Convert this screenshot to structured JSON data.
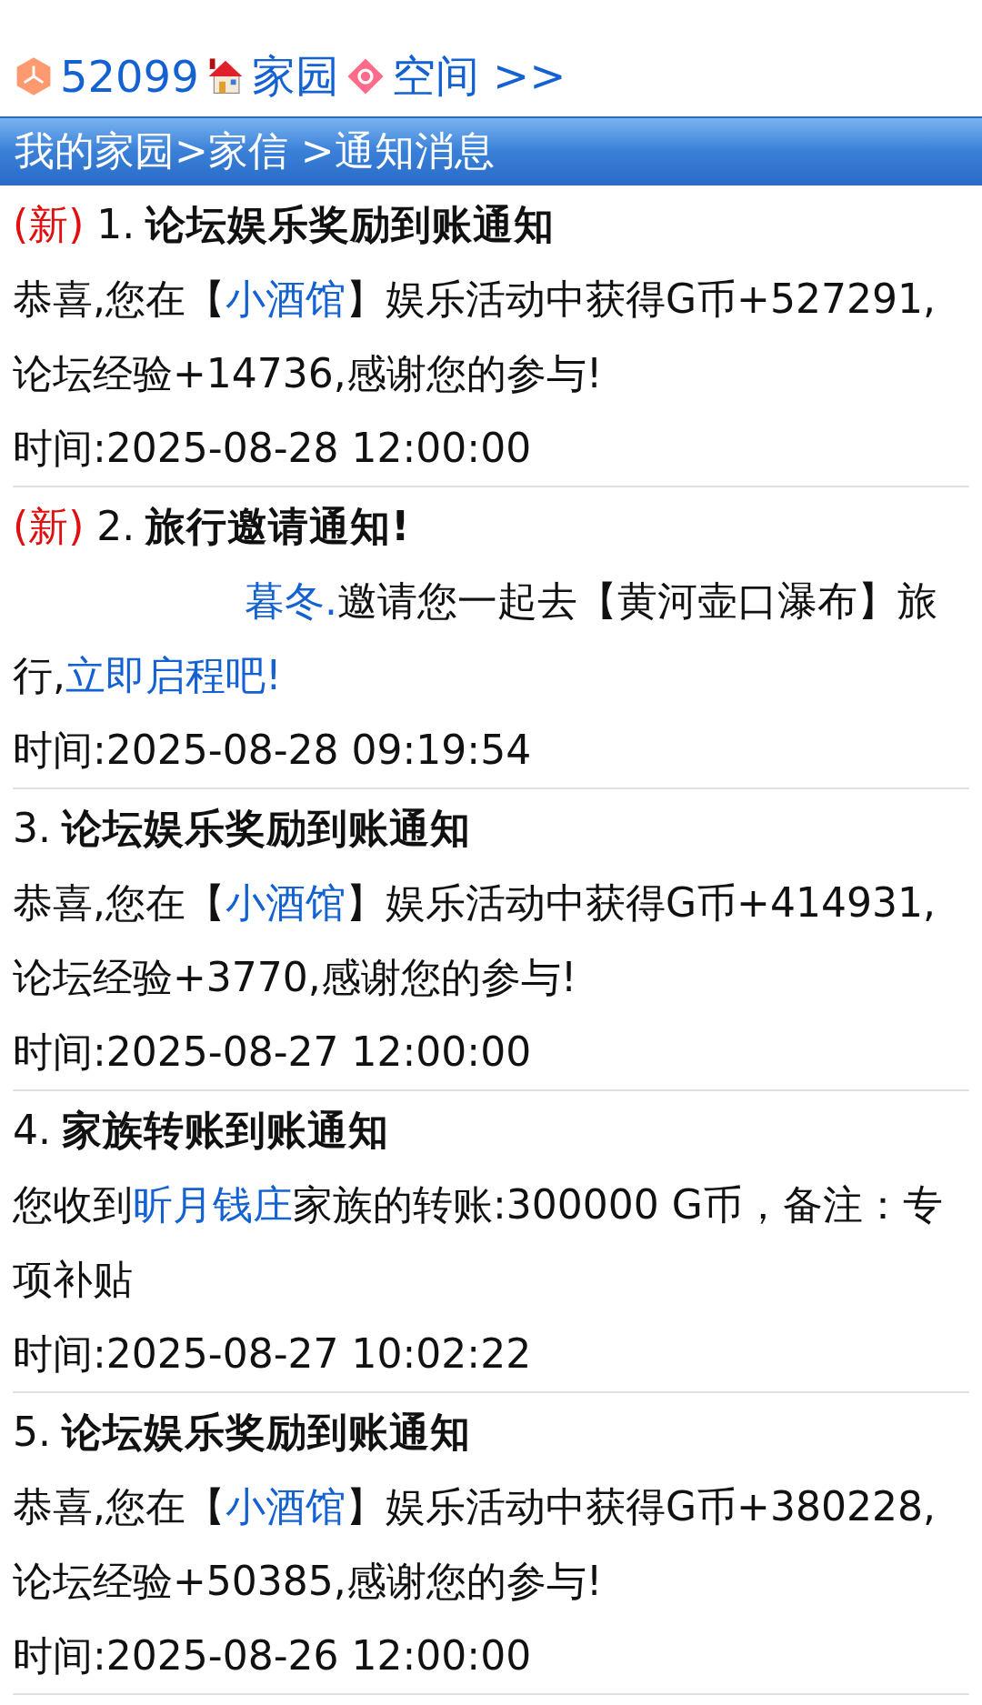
{
  "top_links": [
    {
      "kind": "hexagon",
      "label": "52099"
    },
    {
      "kind": "house",
      "label": "家园"
    },
    {
      "kind": "diamond",
      "label": "空间 >>"
    }
  ],
  "breadcrumb": "我的家园>家信 >通知消息",
  "messages": [
    {
      "new_tag": "(新)",
      "number": "1.",
      "title": "论坛娱乐奖励到账通知",
      "body": [
        {
          "text": "恭喜,您在【",
          "link": false
        },
        {
          "text": "小酒馆",
          "link": true
        },
        {
          "text": "】娱乐活动中获得G币+527291,论坛经验+14736,感谢您的参与!",
          "link": false
        }
      ],
      "time": "时间:2025-08-28 12:00:00"
    },
    {
      "new_tag": "(新)",
      "number": "2.",
      "title": "旅行邀请通知!",
      "indent": true,
      "body": [
        {
          "text": "暮冬.",
          "link": true
        },
        {
          "text": "邀请您一起去【黄河壶口瀑布】旅行,",
          "link": false
        },
        {
          "text": "立即启程吧!",
          "link": true
        }
      ],
      "time": "时间:2025-08-28 09:19:54"
    },
    {
      "number": "3.",
      "title": "论坛娱乐奖励到账通知",
      "body": [
        {
          "text": "恭喜,您在【",
          "link": false
        },
        {
          "text": "小酒馆",
          "link": true
        },
        {
          "text": "】娱乐活动中获得G币+414931,论坛经验+3770,感谢您的参与!",
          "link": false
        }
      ],
      "time": "时间:2025-08-27 12:00:00"
    },
    {
      "number": "4.",
      "title": "家族转账到账通知",
      "body": [
        {
          "text": "您收到",
          "link": false
        },
        {
          "text": "昕月钱庄",
          "link": true
        },
        {
          "text": "家族的转账:300000 G币，备注：专项补贴",
          "link": false
        }
      ],
      "time": "时间:2025-08-27 10:02:22"
    },
    {
      "number": "5.",
      "title": "论坛娱乐奖励到账通知",
      "body": [
        {
          "text": "恭喜,您在【",
          "link": false
        },
        {
          "text": "小酒馆",
          "link": true
        },
        {
          "text": "】娱乐活动中获得G币+380228,论坛经验+50385,感谢您的参与!",
          "link": false
        }
      ],
      "time": "时间:2025-08-26 12:00:00"
    }
  ]
}
